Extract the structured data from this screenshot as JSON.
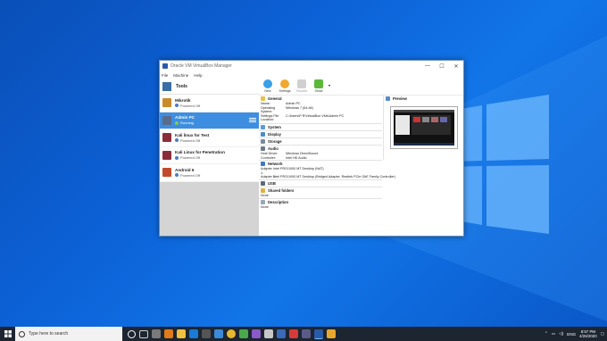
{
  "window": {
    "title": "Oracle VM VirtualBox Manager",
    "controls": {
      "minimize": "—",
      "maximize": "☐",
      "close": "✕"
    },
    "menu": [
      "File",
      "Machine",
      "Help"
    ]
  },
  "tools": {
    "label": "Tools"
  },
  "vms": [
    {
      "name": "Mikrotik",
      "status": "Powered Off",
      "color": "#c98a2a"
    },
    {
      "name": "Admin PC",
      "status": "Running",
      "color": "#5a6c8c",
      "selected": true
    },
    {
      "name": "Kali linux for Test",
      "status": "Powered Off",
      "color": "#8a2f3a"
    },
    {
      "name": "Kali Linux for Penetration",
      "status": "Powered Off",
      "color": "#8a2f3a"
    },
    {
      "name": "Android 6",
      "status": "Powered Off",
      "color": "#c24a2c"
    }
  ],
  "toolbar": {
    "new": "New",
    "settings": "Settings",
    "discard": "Discard",
    "show": "Show"
  },
  "details": {
    "general": {
      "title": "General",
      "rows": [
        {
          "k": "Name:",
          "v": "Admin PC"
        },
        {
          "k": "Operating System:",
          "v": "Windows 7 (64-bit)"
        },
        {
          "k": "Settings File Location:",
          "v": "C:\\Users\\P R\\VirtualBox VMs\\Admin PC"
        }
      ]
    },
    "system": "System",
    "display": "Display",
    "storage": "Storage",
    "audio": {
      "title": "Audio",
      "rows": [
        {
          "k": "Host Driver:",
          "v": "Windows DirectSound"
        },
        {
          "k": "Controller:",
          "v": "Intel HD Audio"
        }
      ]
    },
    "network": {
      "title": "Network",
      "rows": [
        {
          "k": "Adapter 1:",
          "v": "Intel PRO/1000 MT Desktop (NAT)"
        },
        {
          "k": "Adapter 2:",
          "v": "Intel PRO/1000 MT Desktop (Bridged Adapter, Realtek PCIe GbE Family Controller)"
        }
      ]
    },
    "usb": "USB",
    "shared": {
      "title": "Shared folders",
      "value": "None"
    },
    "description": {
      "title": "Description",
      "value": "None"
    }
  },
  "preview": {
    "title": "Preview"
  },
  "taskbar": {
    "search_placeholder": "Type here to search",
    "lang": "ENG",
    "time": "8:57 PM",
    "date": "4/26/2020"
  }
}
